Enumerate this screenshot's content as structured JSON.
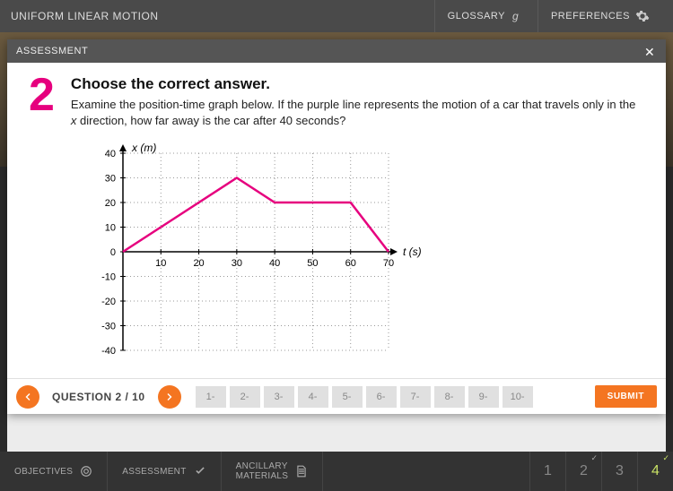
{
  "header": {
    "title": "UNIFORM LINEAR MOTION",
    "glossary": "GLOSSARY",
    "preferences": "PREFERENCES"
  },
  "modal": {
    "title": "ASSESSMENT",
    "question_number": "2",
    "question_title": "Choose the correct answer.",
    "question_text_1": "Examine the position-time graph below. If the purple line represents the motion of a car that travels only in the ",
    "question_text_em": "x",
    "question_text_2": " direction, how far away is the car after 40 seconds?"
  },
  "chart_data": {
    "type": "line",
    "xlabel": "t (s)",
    "ylabel": "x (m)",
    "xlim": [
      0,
      70
    ],
    "ylim": [
      -40,
      40
    ],
    "xticks": [
      10,
      20,
      30,
      40,
      50,
      60,
      70
    ],
    "yticks": [
      -40,
      -30,
      -20,
      -10,
      0,
      10,
      20,
      30,
      40
    ],
    "x": [
      0,
      10,
      30,
      40,
      60,
      70
    ],
    "y": [
      0,
      10,
      30,
      20,
      20,
      0
    ],
    "color": "#e6007e"
  },
  "footer": {
    "question_label": "QUESTION 2 / 10",
    "nav_items": [
      "1-",
      "2-",
      "3-",
      "4-",
      "5-",
      "6-",
      "7-",
      "8-",
      "9-",
      "10-"
    ],
    "submit": "SUBMIT"
  },
  "bottom": {
    "objectives": "OBJECTIVES",
    "assessment": "ASSESSMENT",
    "ancillary_1": "ANCILLARY",
    "ancillary_2": "MATERIALS",
    "sections": [
      "1",
      "2",
      "3",
      "4"
    ],
    "ticked": [
      1,
      3
    ],
    "active": 3
  }
}
